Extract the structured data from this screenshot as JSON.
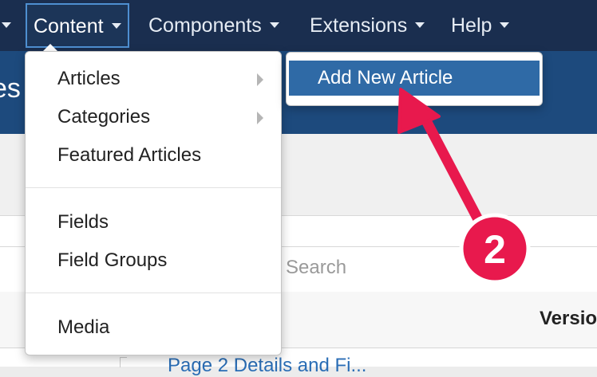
{
  "navbar": {
    "items": [
      {
        "label": "Content"
      },
      {
        "label": "Components"
      },
      {
        "label": "Extensions"
      },
      {
        "label": "Help"
      }
    ]
  },
  "subheader": {
    "title_fragment": "es"
  },
  "content_menu": {
    "items": [
      {
        "label": "Articles",
        "has_submenu": true
      },
      {
        "label": "Categories",
        "has_submenu": true
      },
      {
        "label": "Featured Articles",
        "has_submenu": false
      },
      {
        "label": "Fields",
        "has_submenu": false
      },
      {
        "label": "Field Groups",
        "has_submenu": false
      },
      {
        "label": "Media",
        "has_submenu": false
      }
    ]
  },
  "submenu": {
    "items": [
      {
        "label": "Add New Article"
      }
    ]
  },
  "search": {
    "placeholder": "Search"
  },
  "table": {
    "version_header": "Versio",
    "first_row_link": "Page 2 Details and Fi..."
  },
  "annotation": {
    "badge_number": "2",
    "color": "#e8194d"
  },
  "colors": {
    "navbar": "#1a2e4f",
    "subheader": "#1d4a7d",
    "highlight": "#2f6aa6"
  }
}
